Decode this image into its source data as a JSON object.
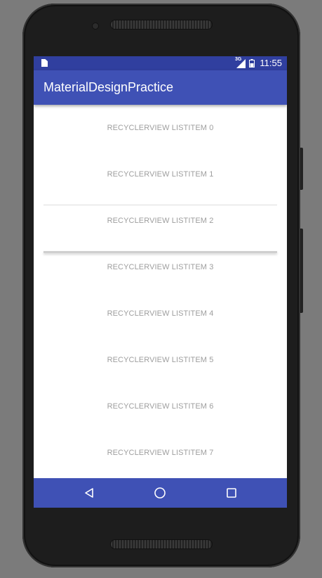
{
  "status_bar": {
    "network_label": "3G",
    "time": "11:55"
  },
  "toolbar": {
    "title": "MaterialDesignPractice"
  },
  "list": {
    "items": [
      {
        "label": "RECYCLERVIEW LISTITEM 0"
      },
      {
        "label": "RECYCLERVIEW LISTITEM 1"
      },
      {
        "label": "RECYCLERVIEW LISTITEM 2"
      },
      {
        "label": "RECYCLERVIEW LISTITEM 3"
      },
      {
        "label": "RECYCLERVIEW LISTITEM 4"
      },
      {
        "label": "RECYCLERVIEW LISTITEM 5"
      },
      {
        "label": "RECYCLERVIEW LISTITEM 6"
      },
      {
        "label": "RECYCLERVIEW LISTITEM 7"
      }
    ]
  },
  "nav_bar": {
    "buttons": [
      "back-icon",
      "home-icon",
      "recents-icon"
    ]
  },
  "colors": {
    "primary": "#3f51b5",
    "primary_dark": "#303f9f",
    "list_text": "#9e9e9e",
    "background": "#ffffff"
  }
}
